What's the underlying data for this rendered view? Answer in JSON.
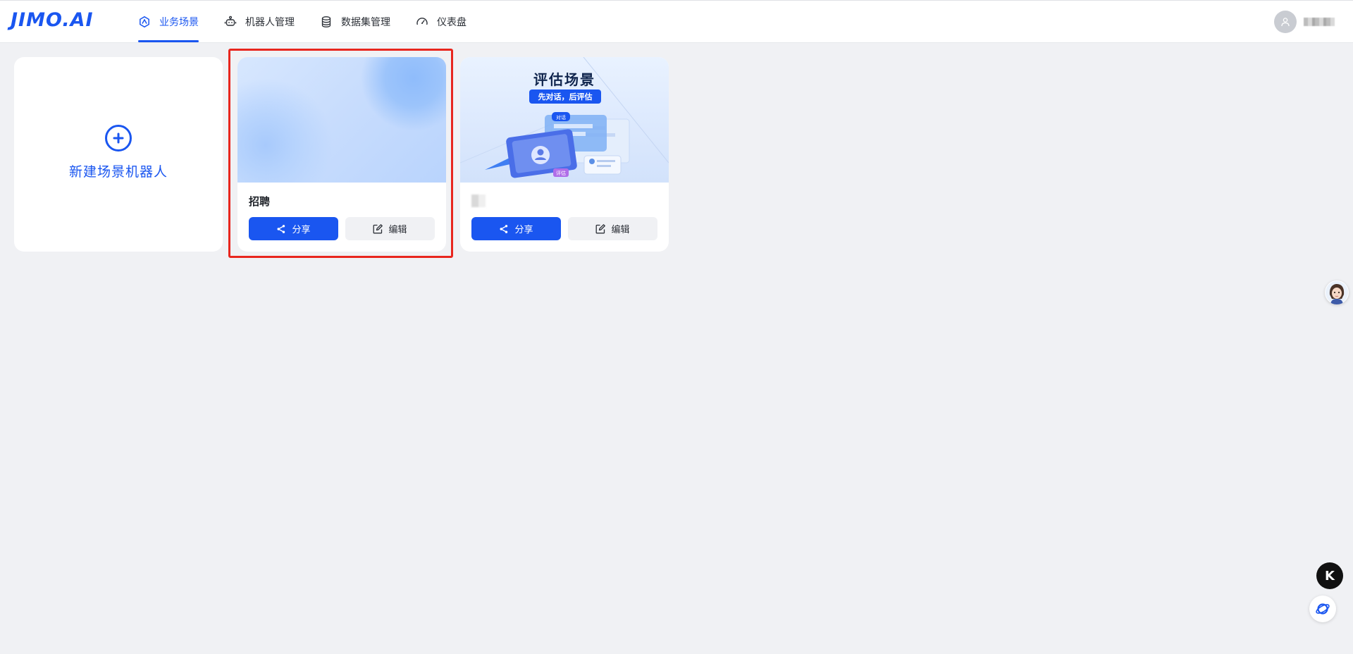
{
  "brand": {
    "logo_text": "JIMO.AI"
  },
  "nav": {
    "items": [
      {
        "label": "业务场景",
        "icon": "scene-icon",
        "active": true
      },
      {
        "label": "机器人管理",
        "icon": "robot-icon",
        "active": false
      },
      {
        "label": "数据集管理",
        "icon": "database-icon",
        "active": false
      },
      {
        "label": "仪表盘",
        "icon": "dashboard-gauge-icon",
        "active": false
      }
    ]
  },
  "user": {
    "avatar_icon": "user-icon"
  },
  "new_card": {
    "label": "新建场景机器人",
    "icon": "plus-circle-icon"
  },
  "cards": [
    {
      "title": "招聘",
      "share_label": "分享",
      "edit_label": "编辑"
    },
    {
      "cover_title": "评估场景",
      "cover_subtitle": "先对话，后评估",
      "cover_tag_dialog": "对话",
      "cover_tag_eval": "评估",
      "share_label": "分享",
      "edit_label": "编辑"
    }
  ],
  "floating": {
    "k_label": "K"
  },
  "colors": {
    "accent": "#1a56f0",
    "background": "#f0f1f4",
    "highlight": "#e8261e"
  }
}
